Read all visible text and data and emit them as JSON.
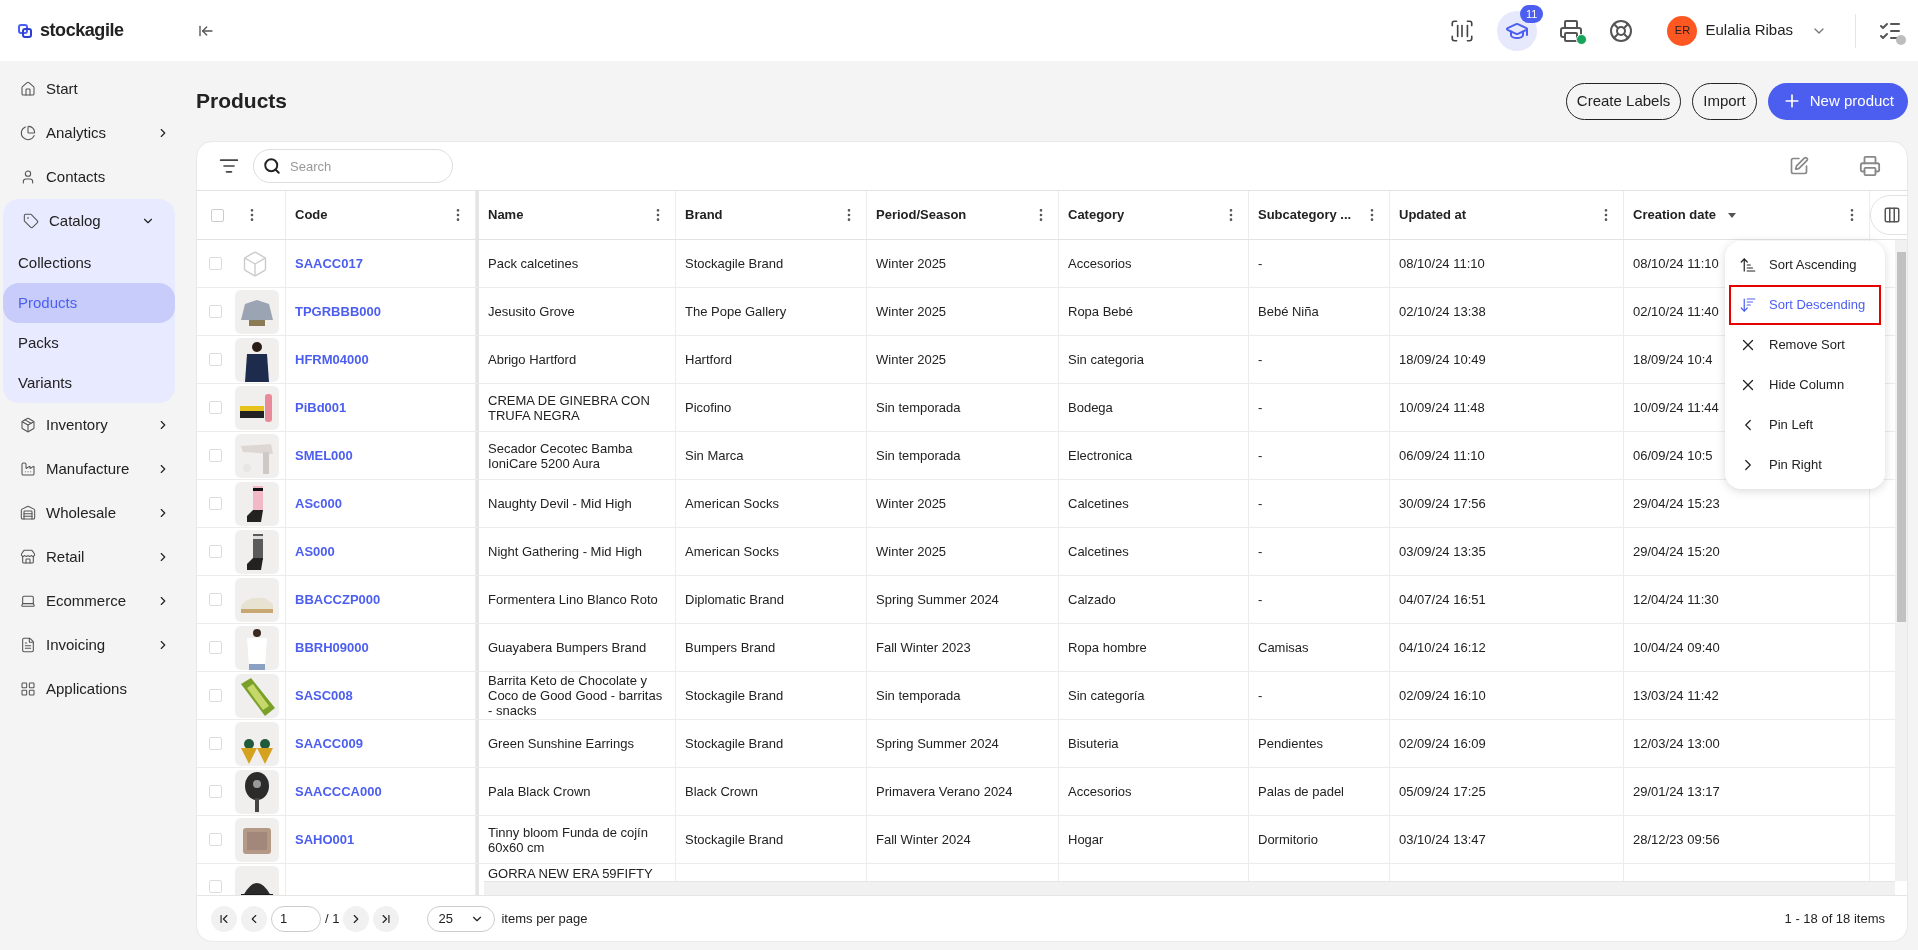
{
  "app": {
    "logo_text": "stockagile"
  },
  "topbar": {
    "academy_badge": "11",
    "user": {
      "initials": "ER",
      "name": "Eulalia Ribas"
    }
  },
  "sidebar": {
    "items": [
      {
        "label": "Start",
        "selected": false
      },
      {
        "label": "Analytics",
        "expanded": false,
        "selected": false
      },
      {
        "label": "Contacts",
        "selected": false
      },
      {
        "label": "Catalog",
        "expanded": true,
        "selected": false,
        "children": [
          {
            "label": "Collections",
            "selected": false
          },
          {
            "label": "Products",
            "selected": true
          },
          {
            "label": "Packs",
            "selected": false
          },
          {
            "label": "Variants",
            "selected": false
          }
        ]
      },
      {
        "label": "Inventory",
        "expanded": false,
        "selected": false
      },
      {
        "label": "Manufacture",
        "expanded": false,
        "selected": false
      },
      {
        "label": "Wholesale",
        "expanded": false,
        "selected": false
      },
      {
        "label": "Retail",
        "expanded": false,
        "selected": false
      },
      {
        "label": "Ecommerce",
        "expanded": false,
        "selected": false
      },
      {
        "label": "Invoicing",
        "expanded": false,
        "selected": false
      },
      {
        "label": "Applications",
        "selected": false
      }
    ]
  },
  "page": {
    "title": "Products",
    "buttons": [
      {
        "label": "Create Labels",
        "kind": "outline"
      },
      {
        "label": "Import",
        "kind": "outline"
      },
      {
        "label": "New product",
        "kind": "primary"
      }
    ]
  },
  "toolbar": {
    "search": {
      "placeholder": "Search"
    }
  },
  "table": {
    "select_all_checked": false,
    "columns": [
      {
        "label": "Code",
        "sorted": false
      },
      {
        "label": "Name",
        "sorted": false
      },
      {
        "label": "Brand",
        "sorted": false
      },
      {
        "label": "Period/Season",
        "sorted": false
      },
      {
        "label": "Category",
        "sorted": false
      },
      {
        "label": "Subcategory ...",
        "sorted": false
      },
      {
        "label": "Updated at",
        "sorted": false
      },
      {
        "label": "Creation date",
        "sorted": true
      }
    ],
    "rows": [
      {
        "checked": false,
        "kind": "placeholder",
        "cells": [
          "SAACC017",
          "Pack calcetines",
          "Stockagile Brand",
          "Winter 2025",
          "Accesorios",
          "-",
          "08/10/24 11:10",
          "08/10/24 11:10"
        ]
      },
      {
        "checked": false,
        "cells": [
          "TPGRBBB000",
          "Jesusito Grove",
          "The Pope Gallery",
          "Winter 2025",
          "Ropa Bebé",
          "Bebé Niña",
          "02/10/24 13:38",
          "02/10/24 11:40"
        ]
      },
      {
        "checked": false,
        "cells": [
          "HFRM04000",
          "Abrigo Hartford",
          "Hartford",
          "Winter 2025",
          "Sin categoria",
          "-",
          "18/09/24 10:49",
          "18/09/24 10:4"
        ]
      },
      {
        "checked": false,
        "cells": [
          "PiBd001",
          "CREMA DE GINEBRA CON TRUFA NEGRA",
          "Picofino",
          "Sin temporada",
          "Bodega",
          "-",
          "10/09/24 11:48",
          "10/09/24 11:44"
        ]
      },
      {
        "checked": false,
        "cells": [
          "SMEL000",
          "Secador Cecotec Bamba IoniCare 5200 Aura",
          "Sin Marca",
          "Sin temporada",
          "Electronica",
          "-",
          "06/09/24 11:10",
          "06/09/24 10:5"
        ]
      },
      {
        "checked": false,
        "cells": [
          "ASc000",
          "Naughty Devil - Mid High",
          "American Socks",
          "Winter 2025",
          "Calcetines",
          "-",
          "30/09/24 17:56",
          "29/04/24 15:23"
        ]
      },
      {
        "checked": false,
        "cells": [
          "AS000",
          "Night Gathering - Mid High",
          "American Socks",
          "Winter 2025",
          "Calcetines",
          "-",
          "03/09/24 13:35",
          "29/04/24 15:20"
        ]
      },
      {
        "checked": false,
        "cells": [
          "BBACCZP000",
          "Formentera Lino Blanco Roto",
          "Diplomatic Brand",
          "Spring Summer 2024",
          "Calzado",
          "-",
          "04/07/24 16:51",
          "12/04/24 11:30"
        ]
      },
      {
        "checked": false,
        "cells": [
          "BBRH09000",
          "Guayabera Bumpers Brand",
          "Bumpers Brand",
          "Fall Winter 2023",
          "Ropa hombre",
          "Camisas",
          "04/10/24 16:12",
          "10/04/24 09:40"
        ]
      },
      {
        "checked": false,
        "cells": [
          "SASC008",
          "Barrita Keto de Chocolate y Coco de Good Good - barritas - snacks",
          "Stockagile Brand",
          "Sin temporada",
          "Sin categoría",
          "-",
          "02/09/24 16:10",
          "13/03/24 11:42"
        ]
      },
      {
        "checked": false,
        "cells": [
          "SAACC009",
          "Green Sunshine Earrings",
          "Stockagile Brand",
          "Spring Summer 2024",
          "Bisuteria",
          "Pendientes",
          "02/09/24 16:09",
          "12/03/24 13:00"
        ]
      },
      {
        "checked": false,
        "cells": [
          "SAACCCA000",
          "Pala Black Crown",
          "Black Crown",
          "Primavera Verano 2024",
          "Accesorios",
          "Palas de padel",
          "05/09/24 17:25",
          "29/01/24 13:17"
        ]
      },
      {
        "checked": false,
        "cells": [
          "SAHO001",
          "Tinny bloom Funda de cojín 60x60 cm",
          "Stockagile Brand",
          "Fall Winter 2024",
          "Hogar",
          "Dormitorio",
          "03/10/24 13:47",
          "28/12/23 09:56"
        ]
      },
      {
        "checked": false,
        "cells": [
          "",
          "GORRA NEW ERA 59FIFTY",
          "",
          "",
          "",
          "",
          "",
          ""
        ]
      }
    ]
  },
  "column_menu": {
    "items": [
      {
        "label": "Sort Ascending",
        "selected": false
      },
      {
        "label": "Sort Descending",
        "selected": true
      },
      {
        "label": "Remove Sort",
        "selected": false
      },
      {
        "label": "Hide Column",
        "selected": false
      },
      {
        "label": "Pin Left",
        "selected": false
      },
      {
        "label": "Pin Right",
        "selected": false
      }
    ]
  },
  "pagination": {
    "page": "1",
    "of_pages": "/ 1",
    "per_page": "25",
    "per_page_label": "items per page",
    "summary": "1 - 18 of 18 items"
  }
}
